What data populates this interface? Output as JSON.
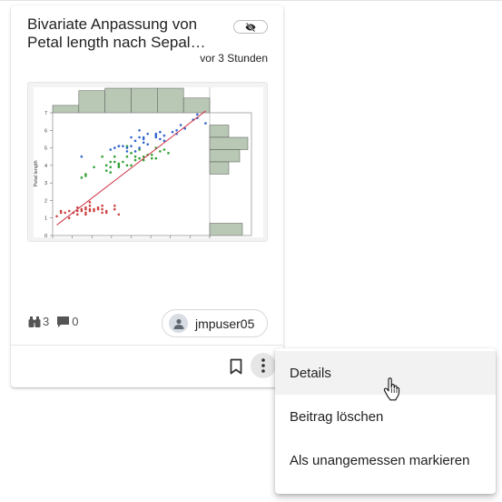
{
  "card": {
    "title_line1": "Bivariate Anpassung von",
    "title_line2": "Petal length nach Sepal…",
    "visibility_icon": "eye-off-icon",
    "timestamp": "vor 3 Stunden",
    "views": "3",
    "comments": "0",
    "author": "jmpuser05"
  },
  "chart_data": {
    "type": "scatter",
    "ylabel": "Petal length",
    "yticks": [
      "0",
      "1",
      "2",
      "3",
      "4",
      "5",
      "6",
      "7"
    ],
    "ylim": [
      0,
      7
    ],
    "xlim": [
      4.2,
      8
    ],
    "fit_line": {
      "x": [
        4.3,
        7.9
      ],
      "y": [
        0.6,
        7.1
      ],
      "color": "#cc3344"
    },
    "series": [
      {
        "color": "#cc4444",
        "points": [
          [
            4.3,
            1.1
          ],
          [
            4.4,
            1.3
          ],
          [
            4.5,
            1.3
          ],
          [
            4.6,
            1.4
          ],
          [
            4.7,
            1.3
          ],
          [
            4.8,
            1.6
          ],
          [
            4.8,
            1.4
          ],
          [
            4.9,
            1.5
          ],
          [
            4.9,
            1.4
          ],
          [
            5.0,
            1.5
          ],
          [
            5.0,
            1.6
          ],
          [
            5.0,
            1.2
          ],
          [
            5.1,
            1.4
          ],
          [
            5.1,
            1.5
          ],
          [
            5.1,
            1.7
          ],
          [
            5.1,
            1.9
          ],
          [
            5.2,
            1.5
          ],
          [
            5.2,
            1.4
          ],
          [
            5.3,
            1.5
          ],
          [
            5.4,
            1.7
          ],
          [
            5.4,
            1.3
          ],
          [
            5.4,
            1.5
          ],
          [
            5.5,
            1.3
          ],
          [
            5.5,
            1.4
          ],
          [
            5.7,
            1.5
          ],
          [
            5.7,
            1.7
          ],
          [
            5.8,
            1.2
          ],
          [
            4.6,
            1.0
          ],
          [
            4.4,
            1.4
          ],
          [
            5.0,
            1.3
          ],
          [
            4.8,
            1.2
          ],
          [
            5.3,
            1.6
          ]
        ]
      },
      {
        "color": "#33a033",
        "points": [
          [
            4.9,
            3.3
          ],
          [
            5.0,
            3.5
          ],
          [
            5.0,
            3.4
          ],
          [
            5.2,
            3.9
          ],
          [
            5.5,
            4.0
          ],
          [
            5.5,
            3.7
          ],
          [
            5.6,
            3.9
          ],
          [
            5.6,
            4.2
          ],
          [
            5.7,
            4.2
          ],
          [
            5.7,
            4.5
          ],
          [
            5.8,
            3.9
          ],
          [
            5.8,
            4.1
          ],
          [
            5.9,
            4.2
          ],
          [
            6.0,
            4.0
          ],
          [
            6.0,
            4.5
          ],
          [
            6.0,
            5.1
          ],
          [
            6.1,
            4.0
          ],
          [
            6.1,
            4.7
          ],
          [
            6.2,
            4.3
          ],
          [
            6.2,
            4.5
          ],
          [
            6.3,
            4.4
          ],
          [
            6.3,
            4.9
          ],
          [
            6.4,
            4.3
          ],
          [
            6.4,
            4.5
          ],
          [
            6.5,
            4.6
          ],
          [
            6.6,
            4.4
          ],
          [
            6.6,
            4.6
          ],
          [
            6.7,
            4.4
          ],
          [
            6.7,
            5.0
          ],
          [
            6.8,
            4.8
          ],
          [
            6.9,
            4.9
          ],
          [
            7.0,
            4.7
          ],
          [
            5.6,
            3.6
          ],
          [
            5.4,
            4.5
          ],
          [
            5.8,
            4.0
          ]
        ]
      },
      {
        "color": "#3366cc",
        "points": [
          [
            4.9,
            4.5
          ],
          [
            5.6,
            4.9
          ],
          [
            5.7,
            5.0
          ],
          [
            5.8,
            5.1
          ],
          [
            5.8,
            5.1
          ],
          [
            5.9,
            5.1
          ],
          [
            6.0,
            4.8
          ],
          [
            6.0,
            5.0
          ],
          [
            6.1,
            5.6
          ],
          [
            6.2,
            4.8
          ],
          [
            6.2,
            5.4
          ],
          [
            6.3,
            5.0
          ],
          [
            6.3,
            5.6
          ],
          [
            6.3,
            6.0
          ],
          [
            6.4,
            5.3
          ],
          [
            6.4,
            5.5
          ],
          [
            6.5,
            5.2
          ],
          [
            6.5,
            5.8
          ],
          [
            6.7,
            5.6
          ],
          [
            6.7,
            5.7
          ],
          [
            6.7,
            5.8
          ],
          [
            6.8,
            5.5
          ],
          [
            6.8,
            5.9
          ],
          [
            6.9,
            5.4
          ],
          [
            6.9,
            5.7
          ],
          [
            7.1,
            5.9
          ],
          [
            7.2,
            6.0
          ],
          [
            7.2,
            5.8
          ],
          [
            7.3,
            6.3
          ],
          [
            7.4,
            6.1
          ],
          [
            7.6,
            6.6
          ],
          [
            7.7,
            6.7
          ],
          [
            7.7,
            6.9
          ],
          [
            7.9,
            6.4
          ],
          [
            6.1,
            5.1
          ],
          [
            6.4,
            5.6
          ]
        ]
      }
    ],
    "top_histogram": [
      0.3,
      0.9,
      1.0,
      1.0,
      1.0,
      0.6
    ],
    "right_histogram": [
      0.0,
      0.35,
      0.7,
      0.55,
      0.35,
      0.0,
      0.0,
      0.0,
      0.0,
      0.6
    ]
  },
  "menu": {
    "items": [
      "Details",
      "Beitrag löschen",
      "Als unangemessen markieren"
    ]
  }
}
